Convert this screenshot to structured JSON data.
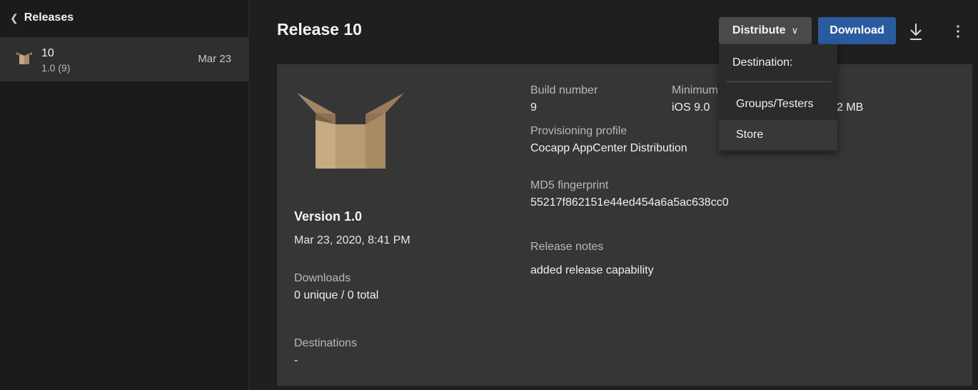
{
  "sidebar": {
    "back_label": "Releases",
    "items": [
      {
        "title": "10",
        "subtitle": "1.0 (9)",
        "date": "Mar 23"
      }
    ]
  },
  "header": {
    "title": "Release 10",
    "distribute_label": "Distribute",
    "download_label": "Download"
  },
  "dropdown": {
    "heading": "Destination:",
    "items": [
      "Groups/Testers",
      "Store"
    ]
  },
  "details": {
    "version": "Version 1.0",
    "date": "Mar 23, 2020, 8:41 PM",
    "downloads_label": "Downloads",
    "downloads_value": "0 unique / 0 total",
    "destinations_label": "Destinations",
    "destinations_value": "-",
    "build_number_label": "Build number",
    "build_number_value": "9",
    "minimum_label": "Minimum",
    "minimum_value": "iOS 9.0",
    "size_value": "2 MB",
    "provisioning_label": "Provisioning profile",
    "provisioning_value": "Cocapp AppCenter Distribution",
    "md5_label": "MD5 fingerprint",
    "md5_value": "55217f862151e44ed454a6a5ac638cc0",
    "release_notes_label": "Release notes",
    "release_notes_value": "added release capability"
  },
  "colors": {
    "accent": "#2a5b9e",
    "background": "#1f1f1f",
    "card": "#363636"
  },
  "icons": [
    "chevron-left-icon",
    "box-icon",
    "chevron-down-icon",
    "download-icon",
    "more-vertical-icon"
  ]
}
